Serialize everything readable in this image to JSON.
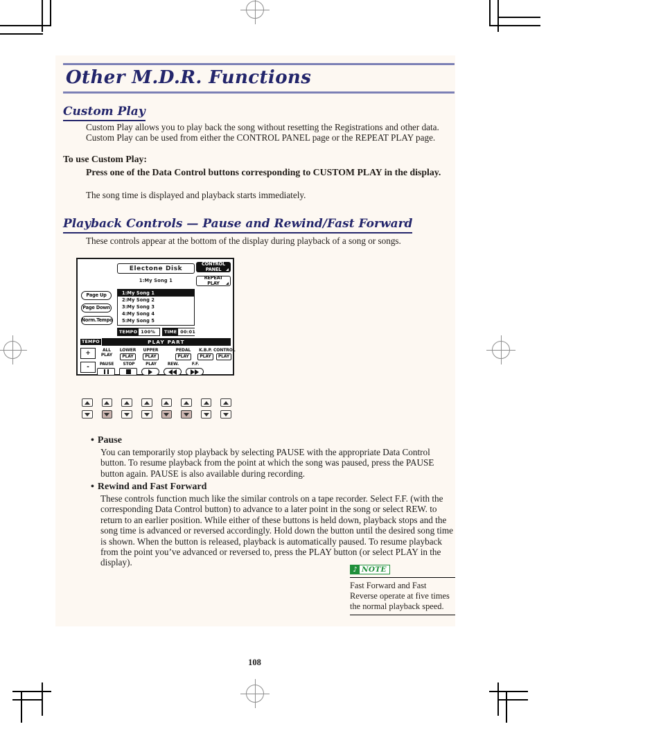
{
  "page": {
    "number": "108",
    "chapter_title": "Other M.D.R. Functions",
    "accent_rule_color": "#7b7fb5",
    "heading_color": "#23256b",
    "tint_color": "#fdf8f2"
  },
  "sections": {
    "custom_play": {
      "heading": "Custom Play",
      "description": "Custom Play allows you to play back the song without resetting the Registrations and other data. Custom Play can be used from either the CONTROL PANEL page or the REPEAT PLAY page.",
      "procedure_heading": "To use Custom Play:",
      "procedure_step": "Press one of the Data Control buttons corresponding to CUSTOM PLAY in the display.",
      "procedure_result": "The song time is displayed and playback starts immediately."
    },
    "playback_controls": {
      "heading": "Playback Controls — Pause and Rewind/Fast Forward",
      "intro": "These controls appear at the bottom of the display during playback of a song or songs.",
      "bullets": [
        {
          "title": "Pause",
          "body": "You can temporarily stop playback by selecting PAUSE with the appropriate Data Control button.  To resume playback from the point at which the song was paused, press the PAUSE button again.  PAUSE is also available during recording."
        },
        {
          "title": "Rewind and Fast Forward",
          "body": "These controls function much like the similar controls on a tape recorder.  Select F.F. (with the corresponding Data Control button) to advance to a later point in the song or select REW. to return to an earlier position.  While either of these buttons is held down, playback stops and the song time is advanced or reversed accordingly.  Hold down the button until the desired song time is shown.  When the button is released, playback is automatically paused.  To resume playback from the point you’ve advanced or reversed to, press the PLAY button (or select PLAY in the display)."
        }
      ]
    }
  },
  "note_box": {
    "badge_glyph": "♪",
    "badge_label": "NOTE",
    "badge_color": "#1f8f3a",
    "text": "Fast Forward and Fast Reverse operate at five times the normal playback speed."
  },
  "lcd": {
    "title": "Electone Disk",
    "current_song": "1:My Song 1",
    "corner_buttons": [
      {
        "label_line1": "CONTROL",
        "label_line2": "PANEL",
        "selected": true
      },
      {
        "label_line1": "REPEAT",
        "label_line2": "PLAY",
        "selected": false
      }
    ],
    "side_buttons": [
      {
        "label": "Page Up"
      },
      {
        "label": "Page Down"
      },
      {
        "label": "Norm.Tempo"
      }
    ],
    "song_list": [
      {
        "label": "1:My Song 1",
        "selected": true
      },
      {
        "label": "2:My Song 2",
        "selected": false
      },
      {
        "label": "3:My Song 3",
        "selected": false
      },
      {
        "label": "4:My Song 4",
        "selected": false
      },
      {
        "label": "5:My Song 5",
        "selected": false
      }
    ],
    "meters": [
      {
        "label": "TEMPO",
        "value": "100%"
      },
      {
        "label": "TIME",
        "value": "00:01"
      }
    ],
    "play_part": {
      "tempo_chip": "TEMPO",
      "bar_label": "PLAY PART",
      "tempo_plus": "+",
      "tempo_minus": "-",
      "parts": [
        {
          "caption": "ALL",
          "sub": "PLAY",
          "boxed": false
        },
        {
          "caption": "LOWER",
          "sub": "PLAY",
          "boxed": true
        },
        {
          "caption": "UPPER",
          "sub": "PLAY",
          "boxed": true
        },
        {
          "caption": "PEDAL",
          "sub": "PLAY",
          "boxed": true
        },
        {
          "caption": "K.B.P.",
          "sub": "PLAY",
          "boxed": true
        },
        {
          "caption": "CONTROL",
          "sub": "PLAY",
          "boxed": true
        }
      ]
    },
    "transport": [
      {
        "caption": "PAUSE",
        "icon": "pause-icon"
      },
      {
        "caption": "STOP",
        "icon": "stop-icon"
      },
      {
        "caption": "PLAY",
        "icon": "play-icon"
      },
      {
        "caption": "REW.",
        "icon": "rewind-icon"
      },
      {
        "caption": "F.F.",
        "icon": "fast-forward-icon"
      }
    ]
  },
  "data_control_buttons": {
    "up_row": [
      {
        "highlighted": false
      },
      {
        "highlighted": false
      },
      {
        "highlighted": false
      },
      {
        "highlighted": false
      },
      {
        "highlighted": false
      },
      {
        "highlighted": false
      },
      {
        "highlighted": false
      },
      {
        "highlighted": false
      }
    ],
    "down_row": [
      {
        "highlighted": false
      },
      {
        "highlighted": true
      },
      {
        "highlighted": false
      },
      {
        "highlighted": false
      },
      {
        "highlighted": true
      },
      {
        "highlighted": true
      },
      {
        "highlighted": false
      },
      {
        "highlighted": false
      }
    ]
  }
}
